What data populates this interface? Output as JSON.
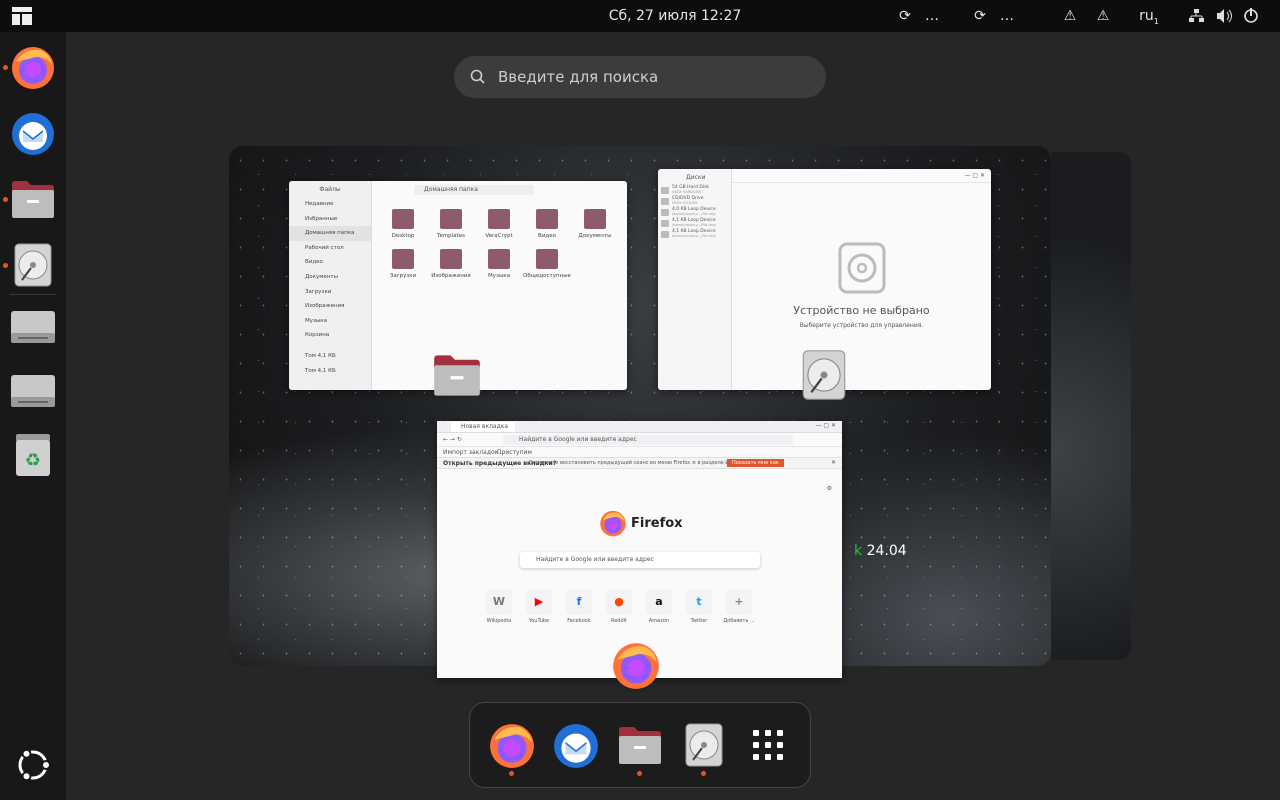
{
  "topbar": {
    "datetime": "Сб, 27 июля  12:27",
    "ellipsis_1": "…",
    "ellipsis_2": "…",
    "keyboard_layout": "ru",
    "keyboard_sub": "1"
  },
  "search": {
    "placeholder": "Введите для поиска"
  },
  "dock": {
    "items": [
      {
        "name": "firefox",
        "running": true
      },
      {
        "name": "thunderbird",
        "running": false
      },
      {
        "name": "files",
        "running": true
      },
      {
        "name": "disks",
        "running": true
      },
      {
        "name": "drive-1",
        "running": false
      },
      {
        "name": "drive-2",
        "running": false
      },
      {
        "name": "trash",
        "running": false
      }
    ]
  },
  "workspace": {
    "os_version": "24.04"
  },
  "files_window": {
    "title": "Файлы",
    "path": "Домашняя папка",
    "sidebar": [
      "Недавние",
      "Избранные",
      "Домашняя папка",
      "Рабочий стол",
      "Видео",
      "Документы",
      "Загрузки",
      "Изображения",
      "Музыка",
      "Корзина",
      "Том 4,1 КБ",
      "Том 4,1 КБ"
    ],
    "folders": [
      "Desktop",
      "Templates",
      "VeraCrypt",
      "Видео",
      "Документы",
      "Загрузки",
      "Изображения",
      "Музыка",
      "Общедоступные"
    ]
  },
  "disks_window": {
    "title": "Диски",
    "devices": [
      {
        "name": "54 GB Hard Disk",
        "sub": "VBOX HARDDISK"
      },
      {
        "name": "CD/DVD Drive",
        "sub": "VBOX CD-ROM"
      },
      {
        "name": "4,0 KB Loop Device",
        "sub": "/home/ubuntu/.../file.img"
      },
      {
        "name": "4,1 KB Loop Device",
        "sub": "/home/ubuntu/.../file.img"
      },
      {
        "name": "4,1 KB Loop Device",
        "sub": "/home/ubuntu/.../file.img"
      }
    ],
    "empty_title": "Устройство не выбрано",
    "empty_sub": "Выберите устройство для управления."
  },
  "firefox_window": {
    "tab_title": "Новая вкладка",
    "url_placeholder": "Найдите в Google или введите адрес",
    "bookmarks": [
      "Импорт закладок...",
      "Приступим"
    ],
    "notice_bold": "Открыть предыдущие вкладки?",
    "notice_text": "Вы можете восстановить предыдущий сеанс во меню Firefox ≡ в разделе История.",
    "notice_button": "Показать мне как",
    "brand": "Firefox",
    "search_placeholder": "Найдите в Google или введите адрес",
    "shortcuts": [
      {
        "label": "Wikipedia",
        "glyph": "W",
        "color": "#777777"
      },
      {
        "label": "YouTube",
        "glyph": "▶",
        "color": "#ff0000"
      },
      {
        "label": "Facebook",
        "glyph": "f",
        "color": "#1877f2"
      },
      {
        "label": "Reddit",
        "glyph": "●",
        "color": "#ff4500"
      },
      {
        "label": "Amazon",
        "glyph": "a",
        "color": "#111111"
      },
      {
        "label": "Twitter",
        "glyph": "t",
        "color": "#1da1f2"
      },
      {
        "label": "Добавить ...",
        "glyph": "+",
        "color": "#888888"
      }
    ]
  },
  "dash": {
    "items": [
      {
        "name": "firefox",
        "running": true
      },
      {
        "name": "thunderbird",
        "running": false
      },
      {
        "name": "files",
        "running": true
      },
      {
        "name": "disks",
        "running": true
      },
      {
        "name": "app-grid",
        "running": false
      }
    ]
  },
  "colors": {
    "accent": "#e95420",
    "topbar": "#0d0d0d",
    "dock": "#181818"
  }
}
